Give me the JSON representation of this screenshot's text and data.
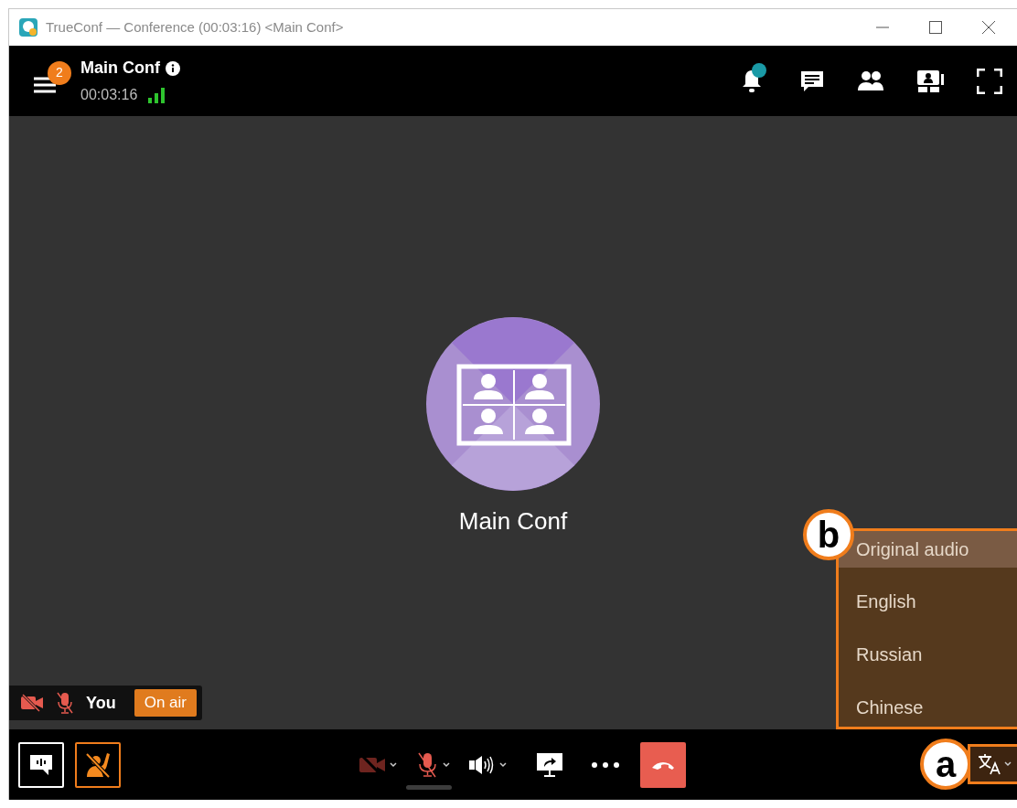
{
  "window": {
    "title": "TrueConf — Conference (00:03:16) <Main Conf>"
  },
  "header": {
    "badge": "2",
    "title": "Main Conf",
    "duration": "00:03:16",
    "notification_dot": true
  },
  "stage": {
    "conference_name": "Main Conf"
  },
  "self_tile": {
    "name": "You",
    "status": "On air",
    "camera_muted": true,
    "mic_muted": true
  },
  "toolbar": {
    "camera_muted": true,
    "mic_muted": true
  },
  "language_menu": {
    "items": [
      {
        "label": "Original audio",
        "selected": true
      },
      {
        "label": "English",
        "selected": false
      },
      {
        "label": "Russian",
        "selected": false
      },
      {
        "label": "Chinese",
        "selected": false
      }
    ]
  },
  "callouts": [
    {
      "label": "a"
    },
    {
      "label": "b"
    }
  ]
}
